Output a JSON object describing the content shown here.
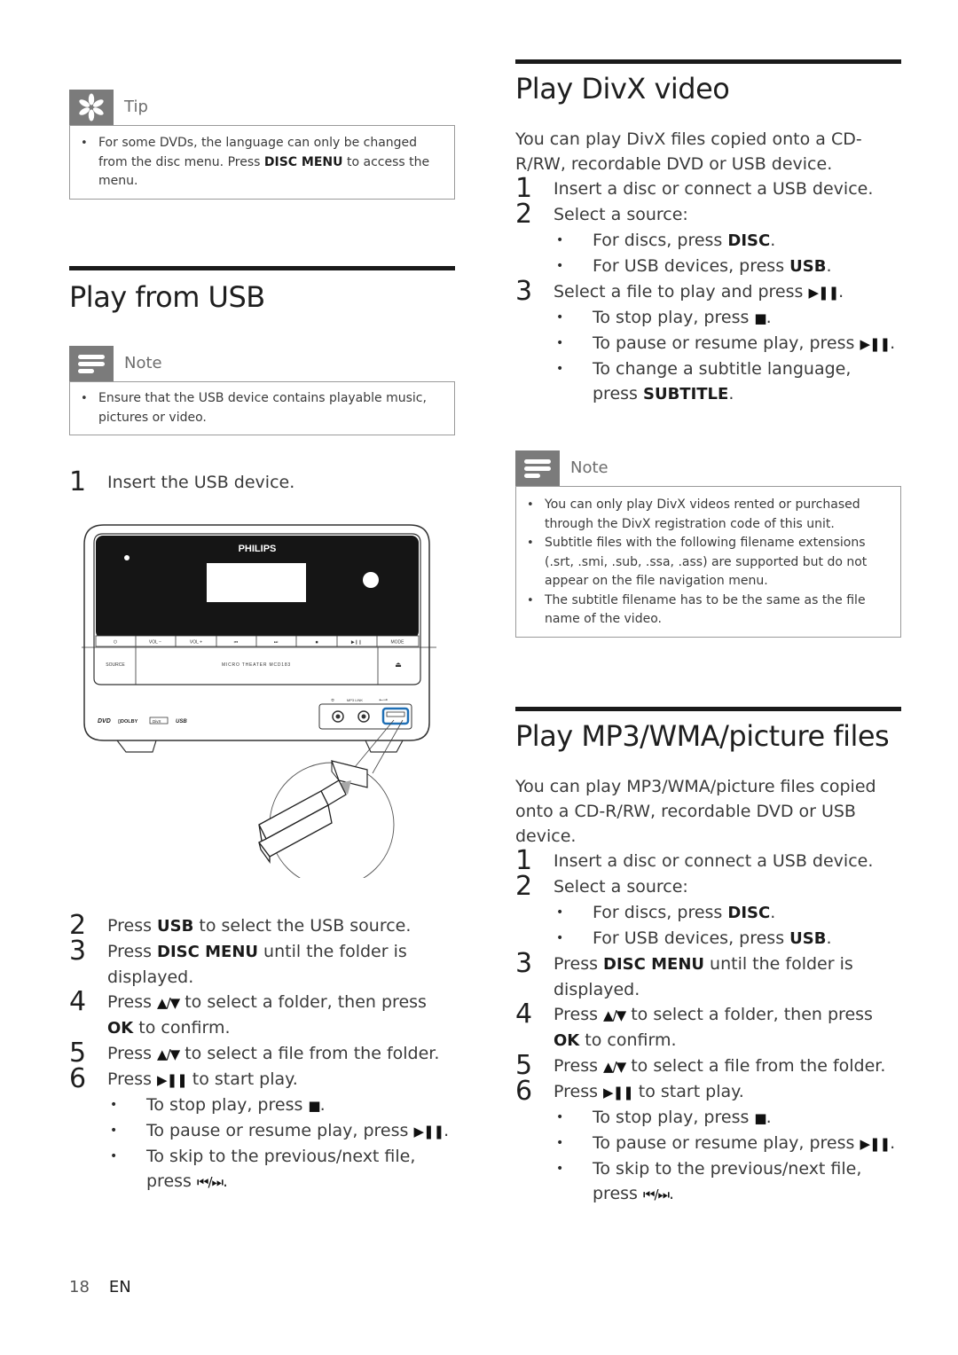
{
  "left": {
    "tip": {
      "label": "Tip",
      "icon": "asterisk-tip-icon",
      "items": [
        {
          "before": "For some DVDs, the language can only be changed from the disc menu. Press ",
          "bold": "DISC MENU",
          "after": " to access the menu."
        }
      ]
    },
    "section_title": "Play from USB",
    "note": {
      "label": "Note",
      "icon": "note-lines-icon",
      "items": [
        "Ensure that the USB device contains playable music, pictures or video."
      ]
    },
    "steps_before_image": [
      {
        "num": "1",
        "text": "Insert the USB device."
      }
    ],
    "illustration": {
      "brand": "PHILIPS",
      "model": "MICRO THEATER MCD183",
      "buttons": [
        "⏻",
        "VOL −",
        "VOL +",
        "⏮",
        "⏭",
        "■",
        "▶❙❙",
        "MODE"
      ],
      "source_label": "SOURCE",
      "eject_symbol": "⏏",
      "port_labels": [
        "℧",
        "MP3 LINK",
        "USB"
      ],
      "logos": [
        "DVD VIDEO",
        "DOLBY DIGITAL",
        "DivX",
        "USB DIRECT"
      ],
      "accent_color": "#1f6fb5"
    },
    "steps_after_image": [
      {
        "num": "2",
        "parts": [
          {
            "t": "Press "
          },
          {
            "b": "USB"
          },
          {
            "t": " to select the USB source."
          }
        ]
      },
      {
        "num": "3",
        "parts": [
          {
            "t": "Press "
          },
          {
            "b": "DISC MENU"
          },
          {
            "t": " until the folder is displayed."
          }
        ]
      },
      {
        "num": "4",
        "parts": [
          {
            "t": "Press "
          },
          {
            "s": "▲/▼"
          },
          {
            "t": " to select a folder, then press "
          },
          {
            "b": "OK"
          },
          {
            "t": " to confirm."
          }
        ]
      },
      {
        "num": "5",
        "parts": [
          {
            "t": "Press "
          },
          {
            "s": "▲/▼"
          },
          {
            "t": " to select a file from the folder."
          }
        ]
      },
      {
        "num": "6",
        "parts": [
          {
            "t": "Press "
          },
          {
            "s": "▶❚❚"
          },
          {
            "t": " to start play."
          }
        ],
        "subs": [
          [
            {
              "t": "To stop play, press "
            },
            {
              "s": "■"
            },
            {
              "t": "."
            }
          ],
          [
            {
              "t": "To pause or resume play, press "
            },
            {
              "s": "▶❚❚"
            },
            {
              "t": "."
            }
          ],
          [
            {
              "t": "To skip to the previous/next file, press "
            },
            {
              "s": "⏮/⏭"
            },
            {
              "t": "."
            }
          ]
        ]
      }
    ]
  },
  "right": {
    "divx": {
      "title": "Play DivX video",
      "intro": "You can play DivX files copied onto a CD-R/RW, recordable DVD or USB device.",
      "steps": [
        {
          "num": "1",
          "parts": [
            {
              "t": "Insert a disc or connect a USB device."
            }
          ]
        },
        {
          "num": "2",
          "parts": [
            {
              "t": "Select a source:"
            }
          ],
          "subs": [
            [
              {
                "t": "For discs, press "
              },
              {
                "b": "DISC"
              },
              {
                "t": "."
              }
            ],
            [
              {
                "t": "For USB devices, press "
              },
              {
                "b": "USB"
              },
              {
                "t": "."
              }
            ]
          ]
        },
        {
          "num": "3",
          "parts": [
            {
              "t": "Select a file to play and press "
            },
            {
              "s": "▶❚❚"
            },
            {
              "t": "."
            }
          ],
          "subs": [
            [
              {
                "t": "To stop play, press "
              },
              {
                "s": "■"
              },
              {
                "t": "."
              }
            ],
            [
              {
                "t": "To pause or resume play, press "
              },
              {
                "s": "▶❚❚"
              },
              {
                "t": "."
              }
            ],
            [
              {
                "t": "To change a subtitle language, press "
              },
              {
                "b": "SUBTITLE"
              },
              {
                "t": "."
              }
            ]
          ]
        }
      ],
      "note": {
        "label": "Note",
        "items": [
          "You can only play DivX videos rented or purchased through the DivX registration code of this unit.",
          "Subtitle files with the following filename extensions (.srt, .smi, .sub, .ssa, .ass) are supported but do not appear on the file navigation menu.",
          "The subtitle filename has to be the same as the file name of the video."
        ]
      }
    },
    "mp3": {
      "title": "Play MP3/WMA/picture files",
      "intro": "You can play MP3/WMA/picture files copied onto a CD-R/RW, recordable DVD or USB device.",
      "steps": [
        {
          "num": "1",
          "parts": [
            {
              "t": "Insert a disc or connect a USB device."
            }
          ]
        },
        {
          "num": "2",
          "parts": [
            {
              "t": "Select a source:"
            }
          ],
          "subs": [
            [
              {
                "t": "For discs, press "
              },
              {
                "b": "DISC"
              },
              {
                "t": "."
              }
            ],
            [
              {
                "t": "For USB devices, press "
              },
              {
                "b": "USB"
              },
              {
                "t": "."
              }
            ]
          ]
        },
        {
          "num": "3",
          "parts": [
            {
              "t": "Press "
            },
            {
              "b": "DISC MENU"
            },
            {
              "t": " until the folder is displayed."
            }
          ]
        },
        {
          "num": "4",
          "parts": [
            {
              "t": "Press "
            },
            {
              "s": "▲/▼"
            },
            {
              "t": " to select a folder, then press "
            },
            {
              "b": "OK"
            },
            {
              "t": " to confirm."
            }
          ]
        },
        {
          "num": "5",
          "parts": [
            {
              "t": "Press "
            },
            {
              "s": "▲/▼"
            },
            {
              "t": " to select a file from the folder."
            }
          ]
        },
        {
          "num": "6",
          "parts": [
            {
              "t": "Press "
            },
            {
              "s": "▶❚❚"
            },
            {
              "t": " to start play."
            }
          ],
          "subs": [
            [
              {
                "t": "To stop play, press "
              },
              {
                "s": "■"
              },
              {
                "t": "."
              }
            ],
            [
              {
                "t": "To pause or resume play, press "
              },
              {
                "s": "▶❚❚"
              },
              {
                "t": "."
              }
            ],
            [
              {
                "t": "To skip to the previous/next file, press "
              },
              {
                "s": "⏮/⏭"
              },
              {
                "t": "."
              }
            ]
          ]
        }
      ]
    }
  },
  "footer": {
    "page_number": "18",
    "language": "EN"
  }
}
